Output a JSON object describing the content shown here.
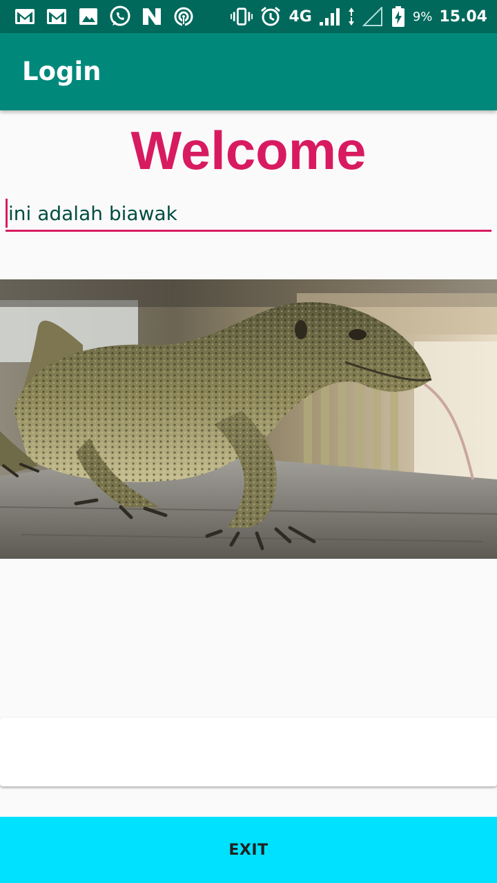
{
  "status_bar": {
    "left_icons": [
      "gmail-icon",
      "gmail-icon",
      "gallery-icon",
      "whatsapp-icon",
      "n-app-icon",
      "hotspot-icon"
    ],
    "right_icons": [
      "vibrate-icon",
      "alarm-icon",
      "signal-icon",
      "data-arrows-icon",
      "no-signal-icon",
      "battery-charging-icon"
    ],
    "network": "4G",
    "battery": "9%",
    "time": "15.04"
  },
  "app_bar": {
    "title": "Login"
  },
  "welcome": "Welcome",
  "text_field": {
    "value": "ini adalah biawak"
  },
  "photo": {
    "subject": "monitor-lizard-photo"
  },
  "exit_button": {
    "label": "EXIT",
    "color": "#00e1ff"
  },
  "colors": {
    "status_bar": "#00695c",
    "app_bar": "#00897b",
    "accent": "#d81b60",
    "field_text": "#004d40"
  }
}
